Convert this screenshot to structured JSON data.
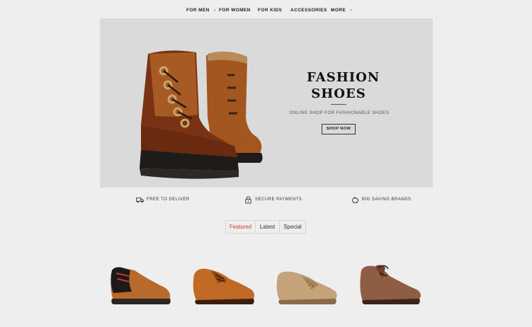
{
  "nav": {
    "items": [
      {
        "label": "FOR MEN",
        "has_dropdown": true
      },
      {
        "label": "FOR WOMEN",
        "has_dropdown": false
      },
      {
        "label": "FOR KIDS",
        "has_dropdown": false
      },
      {
        "label": "ACCESSORIES",
        "has_dropdown": true
      },
      {
        "label": "MORE",
        "has_dropdown": true
      }
    ],
    "chevron": "⌄"
  },
  "hero": {
    "title_line1": "FASHION",
    "title_line2": "SHOES",
    "subtitle": "ONLINE SHOP FOR FASHIONABLE SHOES",
    "button_label": "SHOP NOW",
    "image": "brown-leather-boots"
  },
  "features": [
    {
      "icon": "truck-icon",
      "label": "FREE TO DELIVER"
    },
    {
      "icon": "lock-icon",
      "label": "SECURE PAYMENTS"
    },
    {
      "icon": "piggy-bank-icon",
      "label": "BIG SAVING BRANDS"
    }
  ],
  "tabs": [
    {
      "label": "Featured",
      "active": true
    },
    {
      "label": "Latest",
      "active": false
    },
    {
      "label": "Special",
      "active": false
    }
  ],
  "products": [
    {
      "image": "black-tan-oxford-shoe"
    },
    {
      "image": "tan-brogue-oxford-shoe"
    },
    {
      "image": "beige-perforated-loafer"
    },
    {
      "image": "brown-lace-up-shoe"
    }
  ],
  "colors": {
    "background": "#eeeeee",
    "hero_background": "#dadada",
    "active_tab": "#c0462c",
    "boot_leather": "#7a3214",
    "boot_suede": "#a85a24",
    "sole": "#1e1c1a"
  }
}
